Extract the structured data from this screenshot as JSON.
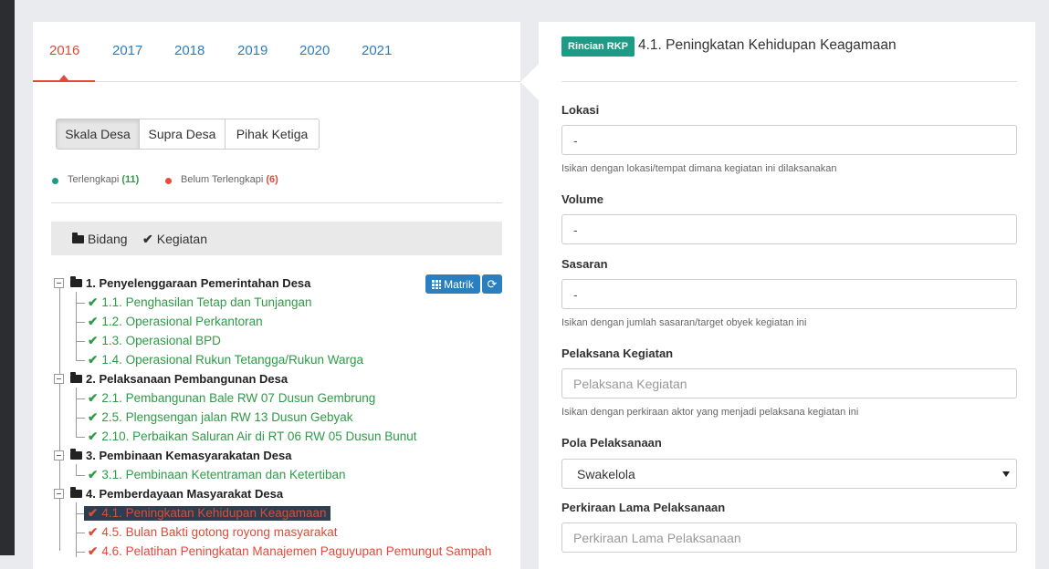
{
  "tabs": [
    {
      "label": "2016",
      "active": true
    },
    {
      "label": "2017"
    },
    {
      "label": "2018"
    },
    {
      "label": "2019"
    },
    {
      "label": "2020"
    },
    {
      "label": "2021"
    }
  ],
  "scope_buttons": [
    "Skala Desa",
    "Supra Desa",
    "Pihak Ketiga"
  ],
  "legend": {
    "complete_label": "Terlengkapi",
    "complete_count": "(11)",
    "incomplete_label": "Belum Terlengkapi",
    "incomplete_count": "(6)",
    "complete_color": "#1e9b85",
    "incomplete_color": "#e74c3c"
  },
  "tree_header": {
    "bidang": "Bidang",
    "kegiatan": "Kegiatan"
  },
  "tree_buttons": {
    "matrik": "Matrik"
  },
  "tree": {
    "g1": "1. Penyelenggaraan Pemerintahan Desa",
    "g1_items": [
      "1.1. Penghasilan Tetap dan Tunjangan",
      "1.2. Operasional Perkantoran",
      "1.3. Operasional BPD",
      "1.4. Operasional Rukun Tetangga/Rukun Warga"
    ],
    "g2": "2. Pelaksanaan Pembangunan Desa",
    "g2_items": [
      "2.1. Pembangunan Bale RW 07 Dusun Gembrung",
      "2.5. Plengsengan jalan RW 13 Dusun Gebyak",
      "2.10. Perbaikan Saluran Air di RT 06 RW 05 Dusun Bunut"
    ],
    "g3": "3. Pembinaan Kemasyarakatan Desa",
    "g3_items": [
      "3.1. Pembinaan Ketentraman dan Ketertiban"
    ],
    "g4": "4. Pemberdayaan Masyarakat Desa",
    "g4_items": [
      "4.1. Peningkatan Kehidupan Keagamaan",
      "4.5. Bulan Bakti gotong royong masyarakat",
      "4.6. Pelatihan Peningkatan Manajemen Paguyupan Pemungut Sampah"
    ]
  },
  "detail": {
    "badge": "Rincian RKP",
    "title": "4.1. Peningkatan Kehidupan Keagamaan",
    "lokasi_label": "Lokasi",
    "lokasi_value": "-",
    "lokasi_help": "Isikan dengan lokasi/tempat dimana kegiatan ini dilaksanakan",
    "volume_label": "Volume",
    "volume_value": "-",
    "sasaran_label": "Sasaran",
    "sasaran_value": "-",
    "sasaran_help": "Isikan dengan jumlah sasaran/target obyek kegiatan ini",
    "pelaksana_label": "Pelaksana Kegiatan",
    "pelaksana_placeholder": "Pelaksana Kegiatan",
    "pelaksana_help": "Isikan dengan perkiraan aktor yang menjadi pelaksana kegiatan ini",
    "pola_label": "Pola Pelaksanaan",
    "pola_value": "Swakelola",
    "lama_label": "Perkiraan Lama Pelaksanaan",
    "lama_placeholder": "Perkiraan Lama Pelaksanaan"
  }
}
